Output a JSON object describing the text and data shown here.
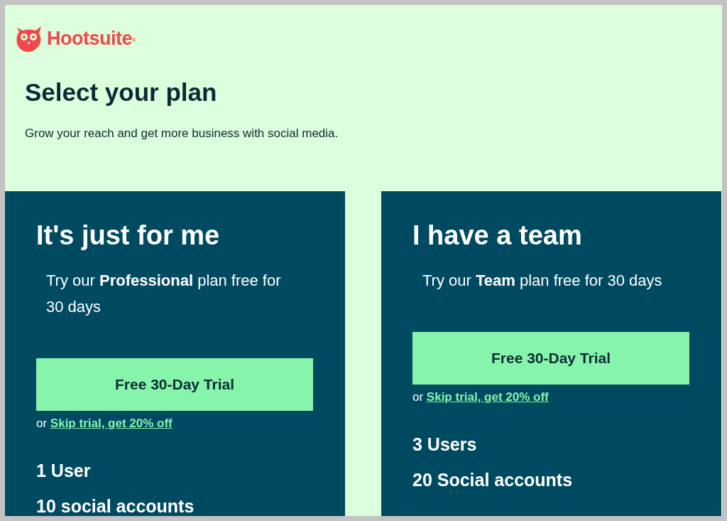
{
  "logo": {
    "text": "Hootsuite$^{®}$"
  },
  "heading": "Select your plan",
  "subheading": "Grow your reach and get more business with social media.",
  "plans": [
    {
      "title": "It's just for me",
      "description": "Try our **Professional** plan free for 30 days",
      "button": "Free 30-Day Trial",
      "skip_prefix": "or",
      "skip_link": "Skip trial, get 20% off",
      "features": [
        "1 User",
        "10 social accounts"
      ]
    },
    {
      "title": "I have a team",
      "description": "Try our **Team** plan free for 30 days",
      "button": "Free 30-Day Trial",
      "skip_prefix": "or",
      "skip_link": "Skip trial, get 20% off",
      "features": [
        "3 Users",
        "20 Social accounts"
      ]
    }
  ]
}
